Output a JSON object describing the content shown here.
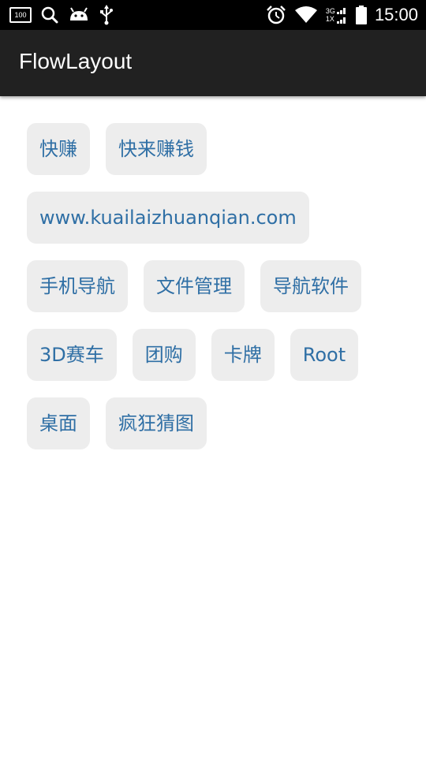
{
  "status_bar": {
    "battery_label": "100",
    "signal_top": "3G",
    "signal_bottom": "1X",
    "time": "15:00"
  },
  "app_bar": {
    "title": "FlowLayout"
  },
  "tags": [
    [
      "快赚",
      "快来赚钱"
    ],
    [
      "www.kuailaizhuanqian.com"
    ],
    [
      "手机导航",
      "文件管理",
      "导航软件"
    ],
    [
      "3D赛车",
      "团购",
      "卡牌",
      "Root"
    ],
    [
      "桌面",
      "疯狂猜图"
    ]
  ],
  "colors": {
    "tag_text": "#2f6fa5",
    "tag_bg": "#ededed",
    "app_bar": "#212121",
    "status_bar": "#000000"
  },
  "icons": [
    "battery-saver-icon",
    "search-icon",
    "android-icon",
    "usb-icon",
    "alarm-icon",
    "wifi-icon",
    "signal-icon",
    "battery-icon"
  ]
}
